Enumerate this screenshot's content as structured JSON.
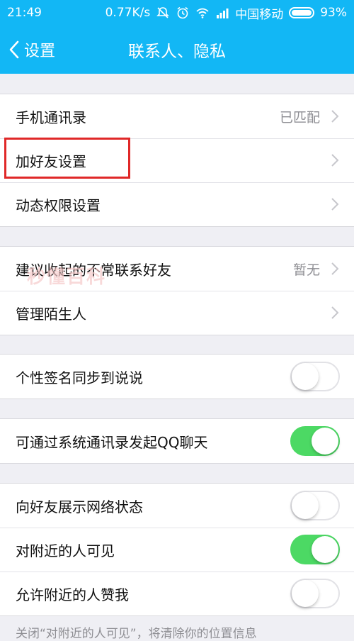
{
  "status_bar": {
    "time": "21:49",
    "speed": "0.77K/s",
    "carrier": "中国移动",
    "battery": "93%"
  },
  "nav": {
    "back_label": "设置",
    "title": "联系人、隐私"
  },
  "groups": [
    {
      "rows": [
        {
          "label": "手机通讯录",
          "value": "已匹配",
          "accessory": "chevron"
        },
        {
          "label": "加好友设置",
          "value": "",
          "accessory": "chevron"
        },
        {
          "label": "动态权限设置",
          "value": "",
          "accessory": "chevron"
        }
      ]
    },
    {
      "rows": [
        {
          "label": "建议收起的不常联系好友",
          "value": "暂无",
          "accessory": "chevron"
        },
        {
          "label": "管理陌生人",
          "value": "",
          "accessory": "chevron"
        }
      ]
    },
    {
      "rows": [
        {
          "label": "个性签名同步到说说",
          "toggle": false
        }
      ]
    },
    {
      "rows": [
        {
          "label": "可通过系统通讯录发起QQ聊天",
          "toggle": true
        }
      ]
    },
    {
      "rows": [
        {
          "label": "向好友展示网络状态",
          "toggle": false
        },
        {
          "label": "对附近的人可见",
          "toggle": true
        },
        {
          "label": "允许附近的人赞我",
          "toggle": false
        }
      ]
    }
  ],
  "watermark": "秒懂百科",
  "footer_note": "关闭“对附近的人可见”，将清除你的位置信息",
  "colors": {
    "header": "#12b7f5",
    "toggle_on": "#4cd964",
    "highlight": "#e02828"
  }
}
